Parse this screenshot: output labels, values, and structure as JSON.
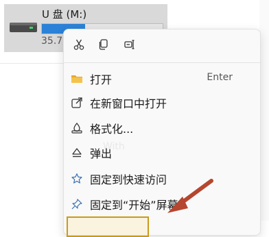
{
  "drive": {
    "name": "U 盘 (M:)",
    "size_text": "35.7",
    "used_fraction": 0.36,
    "icon": "usb-drive-icon"
  },
  "quick_actions": [
    {
      "name": "cut",
      "icon": "scissors-icon"
    },
    {
      "name": "copy",
      "icon": "copy-icon"
    },
    {
      "name": "rename",
      "icon": "rename-icon"
    }
  ],
  "menu": {
    "items": [
      {
        "label": "打开",
        "shortcut": "Enter",
        "icon": "folder-icon"
      },
      {
        "label": "在新窗口中打开",
        "icon": "open-new-window-icon"
      },
      {
        "label": "格式化...",
        "icon": "format-drive-icon"
      },
      {
        "label": "弹出",
        "icon": "eject-icon"
      },
      {
        "label": "固定到快速访问",
        "icon": "star-icon"
      },
      {
        "label": "固定到“开始”屏幕",
        "icon": "pin-icon"
      }
    ]
  },
  "watermark": "With",
  "colors": {
    "accent": "#2b82d8",
    "annotation_arrow": "#b5462f",
    "annotation_box": "#c99a1a",
    "folder": "#e8a92a"
  }
}
